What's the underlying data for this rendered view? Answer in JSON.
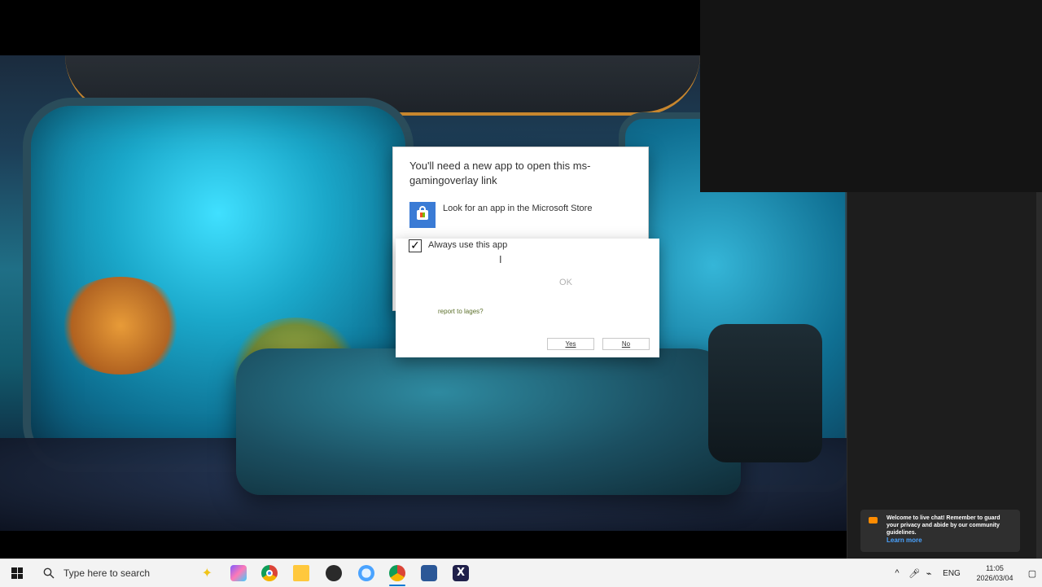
{
  "dialog": {
    "title": "You'll need a new app to open this ms-gamingoverlay link",
    "store_option_label": "Look for an app in the Microsoft Store",
    "always_use_label": "Always use this app",
    "always_use_checked": true,
    "ok_label": "OK",
    "report_link": "report to lages?",
    "yes_label": "Yes",
    "no_label": "No"
  },
  "toast": {
    "message": "Welcome to live chat! Remember to guard your privacy and abide by our community guidelines.",
    "link_label": "Learn more",
    "icon_color": "#ff8c00"
  },
  "taskbar": {
    "search_placeholder": "Type here to search",
    "apps": [
      "copilot-icon",
      "chrome-icon",
      "file-explorer-icon",
      "obs-icon",
      "snipping-tool-icon",
      "chrome-icon",
      "word-icon",
      "x-app-icon"
    ],
    "tray": {
      "language": "ENG",
      "time": "11:05",
      "date": "2026/03/04"
    }
  },
  "colors": {
    "accent": "#0078d4",
    "dialog_bg": "#ffffff",
    "toast_bg": "#2f2f2f",
    "taskbar_bg": "#f3f3f3"
  }
}
